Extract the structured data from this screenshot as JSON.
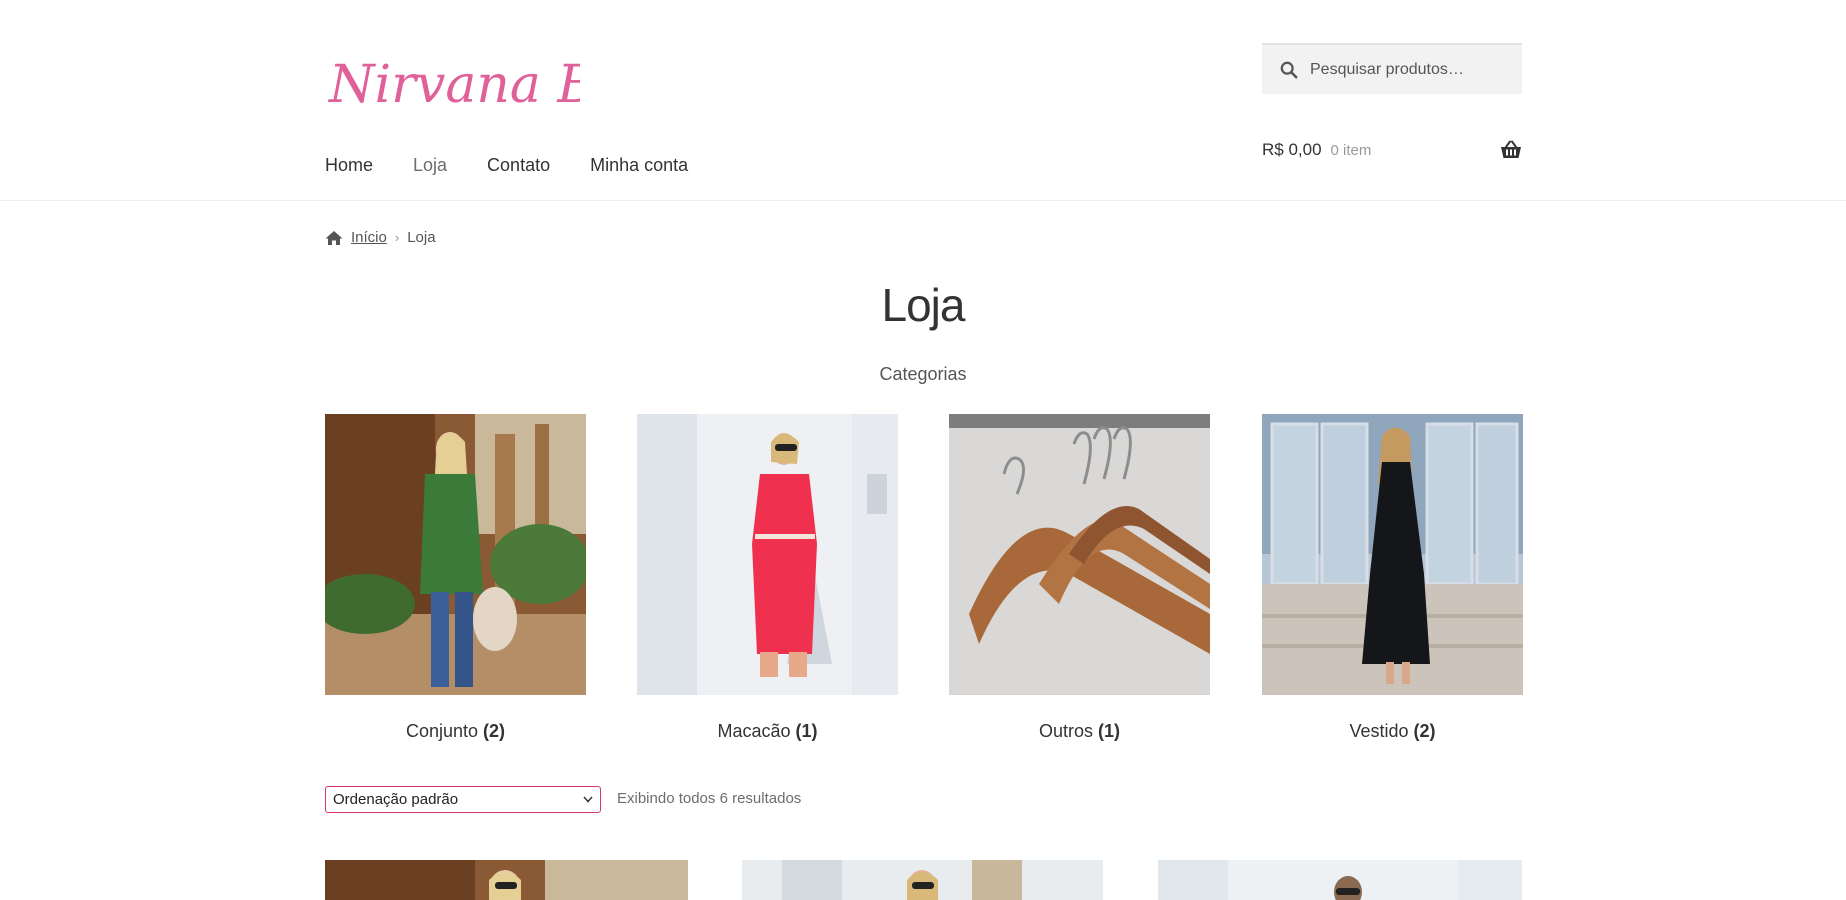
{
  "brand": {
    "logo_text": "Nirvana BoH",
    "color": "#e0609a"
  },
  "search": {
    "placeholder": "Pesquisar produtos…"
  },
  "nav": {
    "items": [
      "Home",
      "Loja",
      "Contato",
      "Minha conta"
    ],
    "current": "Loja"
  },
  "cart": {
    "amount": "R$ 0,00",
    "count": "0 item"
  },
  "breadcrumb": {
    "home": "Início",
    "separator": "›",
    "current": "Loja"
  },
  "page": {
    "title": "Loja",
    "subtitle": "Categorias"
  },
  "categories": [
    {
      "name": "Conjunto",
      "count": "(2)"
    },
    {
      "name": "Macacão",
      "count": "(1)"
    },
    {
      "name": "Outros",
      "count": "(1)"
    },
    {
      "name": "Vestido",
      "count": "(2)"
    }
  ],
  "ordering": {
    "selected": "Ordenação padrão",
    "results": "Exibindo todos 6 resultados"
  },
  "colors": {
    "accent": "#d6356f",
    "text": "#43454b",
    "muted": "#6d6d6d"
  }
}
